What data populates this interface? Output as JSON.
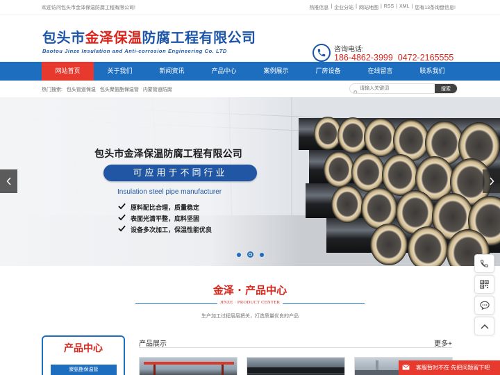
{
  "topbar": {
    "welcome": "欢迎访问包头市金泽保温防腐工程有限公司!",
    "links": [
      "热推信息",
      "|",
      "企业分站",
      "|",
      "网站地图",
      "|",
      "RSS",
      "|",
      "XML",
      "|",
      "您有13条询盘信息!"
    ]
  },
  "header": {
    "logo_cn_prefix": "包头市",
    "logo_cn_red": "金泽保温",
    "logo_cn_suffix": "防腐工程有限公司",
    "logo_en": "Baotou Jinze Insulation and Anti-corrosion Engineering Co. LTD",
    "hotline_label": "咨询电话:",
    "hotline_numbers": "186-4862-3999  0472-2165555"
  },
  "nav": {
    "items": [
      "网站首页",
      "关于我们",
      "新闻资讯",
      "产品中心",
      "案例展示",
      "厂房设备",
      "在线留言",
      "联系我们"
    ]
  },
  "hotsearch": {
    "label": "热门搜索:",
    "terms": [
      "包头管道保温",
      "包头聚氨酯保温管",
      "内蒙管道防腐"
    ],
    "placeholder": "请输入关键词",
    "button": "搜索"
  },
  "banner": {
    "title": "包头市金泽保温防腐工程有限公司",
    "pill": "可应用于不同行业",
    "english": "Insulation steel pipe manufacturer",
    "points": [
      "原料配比合理，质量稳定",
      "表面光清平整，底料坚固",
      "设备多次加工，保温性能优良"
    ]
  },
  "product_center": {
    "title": "金泽 · 产品中心",
    "subtitle": "JINZE · PRODUCT CENTER",
    "description": "生产加工过程层层把关，打造质量优良的产品"
  },
  "sidebar": {
    "title": "产品中心",
    "first_item": "聚氨酯保温管"
  },
  "product_display": {
    "title": "产品展示",
    "more": "更多+"
  },
  "customer_service": {
    "text": "客服暂时不在 先把问题留下吧"
  },
  "colors": {
    "brand_blue": "#1d6ebf",
    "brand_red": "#d9261c",
    "nav_active": "#e8392e"
  },
  "icons": [
    "phone-icon",
    "search-icon",
    "check-icon",
    "chevron-left-icon",
    "chevron-right-icon",
    "qrcode-icon",
    "chat-icon",
    "chevron-up-icon",
    "mail-icon"
  ]
}
